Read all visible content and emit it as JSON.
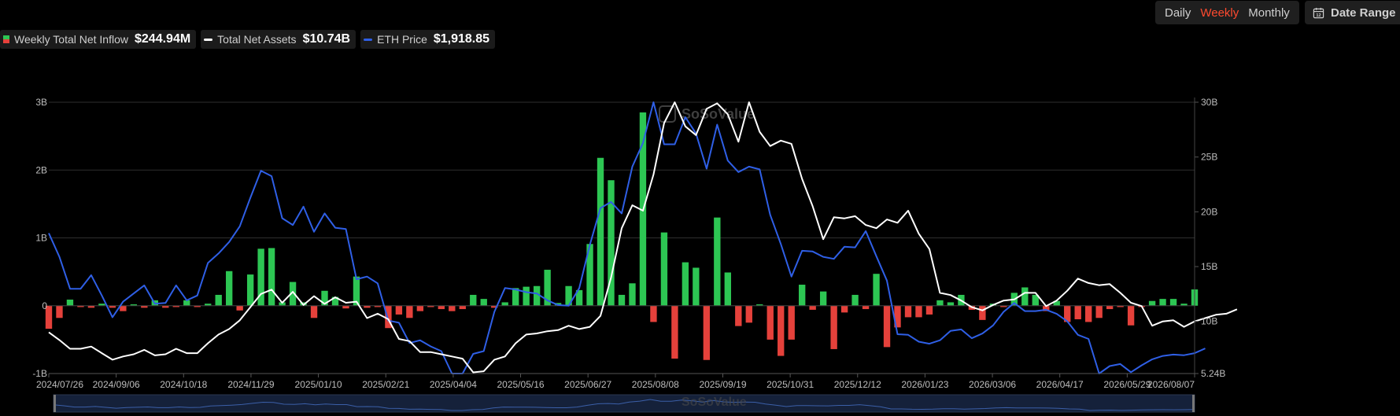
{
  "controls": {
    "periods": [
      "Daily",
      "Weekly",
      "Monthly"
    ],
    "active_period": "Weekly",
    "date_range_label": "Date Range"
  },
  "legend": [
    {
      "label": "Weekly Total Net Inflow",
      "value": "$244.94M"
    },
    {
      "label": "Total Net Assets",
      "value": "$10.74B"
    },
    {
      "label": "ETH Price",
      "value": "$1,918.85"
    }
  ],
  "watermark": "SoSoValue",
  "colors": {
    "inflow_positive": "#2dc653",
    "inflow_negative": "#e5413b",
    "net_assets_line": "#ffffff",
    "eth_price_line": "#2f5fe6",
    "grid": "#2e2e2e",
    "axis_text": "#bdbdbd",
    "active_period": "#ff4a2f"
  },
  "chart_data": {
    "type": "bar",
    "x_tick_labels": [
      "2024/07/26",
      "2024/09/06",
      "2024/10/18",
      "2024/11/29",
      "2025/01/10",
      "2025/02/21",
      "2025/04/04",
      "2025/05/16",
      "2025/06/27",
      "2025/08/08",
      "2025/09/19",
      "2025/10/31",
      "2025/12/12",
      "2026/01/23",
      "2026/03/06",
      "2026/04/17",
      "2026/05/29",
      "2026/08/07"
    ],
    "x_start": "2024/07/26",
    "x_end": "2026/08/07",
    "left_axis": {
      "ticks": [
        "3B",
        "2B",
        "1B",
        "0",
        "-1B"
      ],
      "tick_values": [
        3,
        2,
        1,
        0,
        -1
      ],
      "ylim": [
        -1,
        3
      ],
      "unit": "B"
    },
    "right_axis": {
      "ticks": [
        "30B",
        "25B",
        "20B",
        "15B",
        "10B",
        "5.24B"
      ],
      "tick_values": [
        30,
        25,
        20,
        15,
        10,
        5.24
      ],
      "ylim": [
        5.24,
        30
      ],
      "unit": "B"
    },
    "series": [
      {
        "name": "Weekly Total Net Inflow",
        "axis": "left",
        "kind": "bar",
        "values": [
          -0.34,
          -0.18,
          0.09,
          -0.02,
          -0.03,
          0.03,
          -0.03,
          -0.08,
          0.02,
          -0.03,
          0.08,
          -0.03,
          -0.02,
          0.08,
          -0.02,
          0.03,
          0.16,
          0.51,
          -0.07,
          0.46,
          0.84,
          0.85,
          0.05,
          0.35,
          0.05,
          -0.18,
          0.22,
          0.13,
          -0.04,
          0.43,
          -0.03,
          -0.02,
          -0.33,
          -0.13,
          -0.18,
          -0.08,
          -0.02,
          -0.05,
          -0.08,
          -0.05,
          0.16,
          0.1,
          -0.03,
          0.05,
          0.26,
          0.28,
          0.29,
          0.53,
          0.04,
          0.29,
          0.23,
          0.91,
          2.18,
          1.85,
          0.16,
          0.33,
          2.85,
          -0.24,
          1.08,
          -0.78,
          0.64,
          0.56,
          -0.8,
          1.3,
          0.49,
          -0.3,
          -0.25,
          0.02,
          -0.5,
          -0.74,
          -0.5,
          0.31,
          -0.06,
          0.21,
          -0.64,
          -0.1,
          0.16,
          -0.05,
          0.47,
          -0.61,
          -0.32,
          -0.17,
          -0.17,
          -0.13,
          0.08,
          0.05,
          0.16,
          -0.06,
          -0.21,
          0.03,
          -0.02,
          0.19,
          0.27,
          0.16,
          -0.08,
          0.07,
          -0.24,
          -0.2,
          -0.24,
          -0.18,
          -0.05,
          -0.02,
          -0.29,
          -0.02,
          0.07,
          0.1,
          0.1,
          0.03,
          0.24
        ]
      },
      {
        "name": "Total Net Assets",
        "axis": "right",
        "kind": "line",
        "values": [
          9.0,
          8.3,
          7.5,
          7.5,
          7.7,
          7.1,
          6.5,
          6.8,
          7.0,
          7.4,
          6.9,
          7.0,
          7.5,
          7.1,
          7.1,
          8.0,
          8.8,
          9.3,
          10.1,
          11.3,
          12.5,
          12.9,
          11.7,
          12.7,
          11.5,
          12.3,
          11.6,
          12.2,
          11.7,
          11.8,
          10.3,
          10.7,
          10.2,
          8.4,
          8.2,
          7.2,
          7.2,
          7.0,
          6.8,
          6.6,
          5.35,
          5.45,
          6.5,
          6.8,
          8.0,
          8.8,
          8.9,
          9.1,
          9.2,
          9.6,
          9.3,
          9.5,
          10.5,
          14.0,
          18.5,
          20.6,
          20.1,
          23.4,
          28.1,
          30.0,
          27.8,
          27.0,
          29.4,
          29.9,
          28.9,
          26.4,
          30.0,
          27.3,
          26.0,
          26.5,
          26.2,
          23.0,
          20.5,
          17.5,
          19.5,
          19.4,
          19.6,
          18.8,
          18.5,
          19.3,
          19.0,
          20.1,
          18.0,
          16.6,
          12.6,
          12.4,
          11.9,
          11.3,
          11.0,
          11.5,
          11.9,
          12.0,
          12.6,
          12.6,
          11.4,
          11.9,
          12.8,
          13.9,
          13.5,
          13.3,
          13.4,
          12.6,
          11.7,
          11.4,
          9.6,
          10.0,
          10.1,
          9.5,
          10.0,
          10.3,
          10.6,
          10.7,
          11.1
        ]
      },
      {
        "name": "ETH Price",
        "axis": "left",
        "kind": "line",
        "values": [
          1.07,
          0.72,
          0.25,
          0.25,
          0.45,
          0.15,
          -0.17,
          0.06,
          0.18,
          0.3,
          0.03,
          0.04,
          0.3,
          0.08,
          0.15,
          0.63,
          0.77,
          0.94,
          1.17,
          1.59,
          1.99,
          1.91,
          1.29,
          1.19,
          1.46,
          1.09,
          1.36,
          1.15,
          1.13,
          0.39,
          0.43,
          0.33,
          -0.22,
          -0.25,
          -0.55,
          -0.51,
          -0.6,
          -0.67,
          -1.0,
          -1.0,
          -0.71,
          -0.67,
          -0.09,
          0.26,
          0.24,
          0.2,
          0.18,
          0.08,
          0.01,
          0.0,
          0.26,
          0.9,
          1.44,
          1.53,
          1.36,
          2.05,
          2.4,
          3.0,
          2.38,
          2.38,
          2.78,
          2.54,
          2.02,
          2.67,
          2.14,
          1.97,
          2.05,
          2.01,
          1.34,
          0.91,
          0.43,
          0.81,
          0.8,
          0.72,
          0.69,
          0.87,
          0.86,
          1.1,
          0.73,
          0.37,
          -0.42,
          -0.43,
          -0.53,
          -0.56,
          -0.51,
          -0.37,
          -0.35,
          -0.48,
          -0.41,
          -0.29,
          -0.09,
          0.04,
          -0.08,
          -0.08,
          -0.06,
          -0.12,
          -0.23,
          -0.43,
          -0.49,
          -1.0,
          -0.89,
          -0.86,
          -0.98,
          -0.88,
          -0.79,
          -0.74,
          -0.72,
          -0.73,
          -0.7,
          -0.63
        ]
      }
    ],
    "grid": true,
    "legend_position": "top-left"
  }
}
